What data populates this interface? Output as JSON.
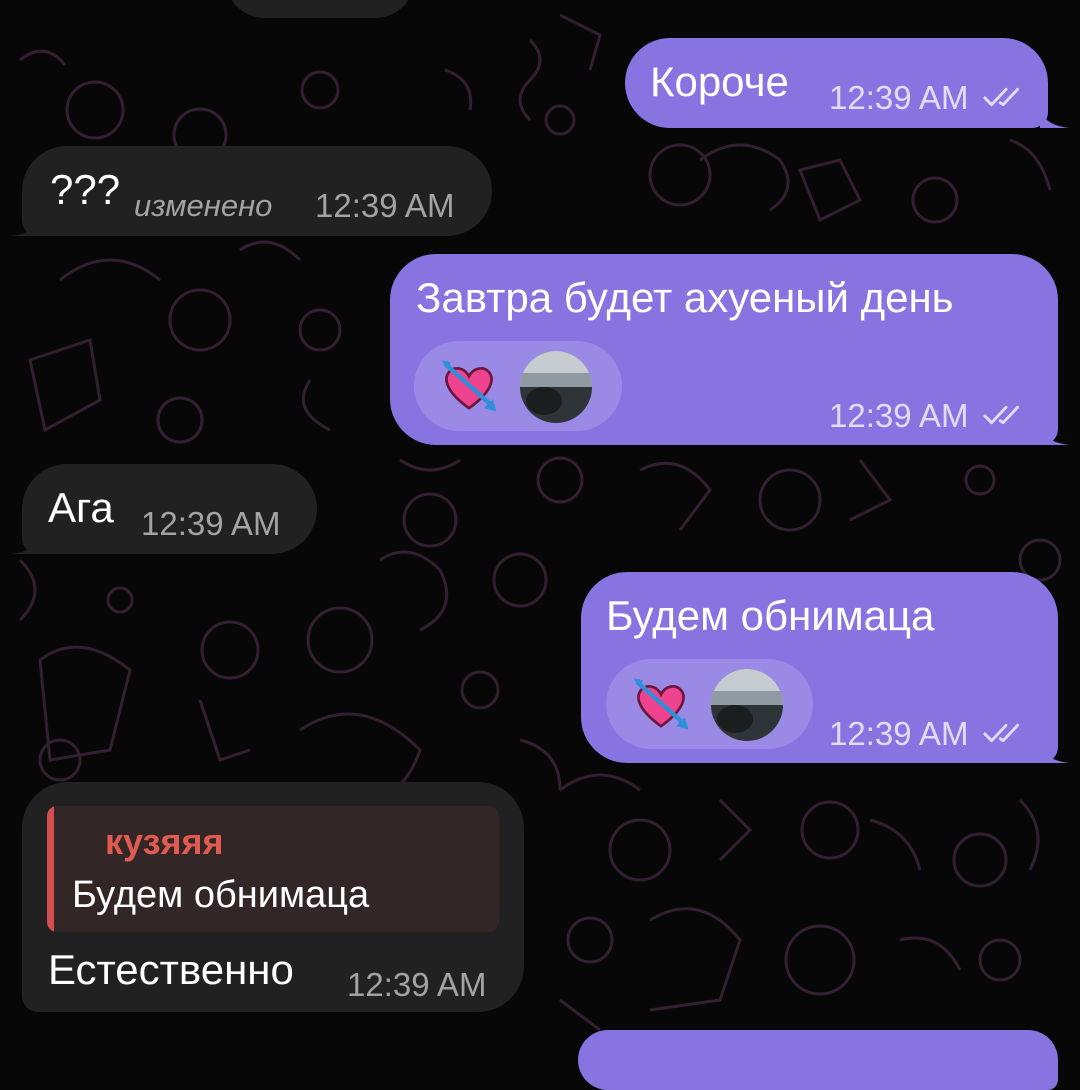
{
  "messages": [
    {
      "direction": "outgoing",
      "text": "Короче",
      "time": "12:39 AM"
    },
    {
      "direction": "incoming",
      "text": "???",
      "edited": "изменено",
      "time": "12:39 AM"
    },
    {
      "direction": "outgoing",
      "text": "Завтра будет ахуеный день",
      "time": "12:39 AM",
      "reaction": {
        "emoji": "heart-with-arrow",
        "has_avatar": true
      }
    },
    {
      "direction": "incoming",
      "text": "Ага",
      "time": "12:39 AM"
    },
    {
      "direction": "outgoing",
      "text": "Будем обнимаца",
      "time": "12:39 AM",
      "reaction": {
        "emoji": "heart-with-arrow",
        "has_avatar": true
      }
    },
    {
      "direction": "incoming",
      "text": "Естественно",
      "time": "12:39 AM",
      "reply": {
        "name": "кузяяя",
        "text": "Будем обнимаца"
      }
    }
  ],
  "colors": {
    "outgoing_bubble": "#8774e1",
    "incoming_bubble": "#212121",
    "background": "#070707",
    "reply_name": "#e15b50",
    "reply_bar": "#d24f4f",
    "heart": "#f0438f",
    "arrow": "#2f8fd8"
  }
}
